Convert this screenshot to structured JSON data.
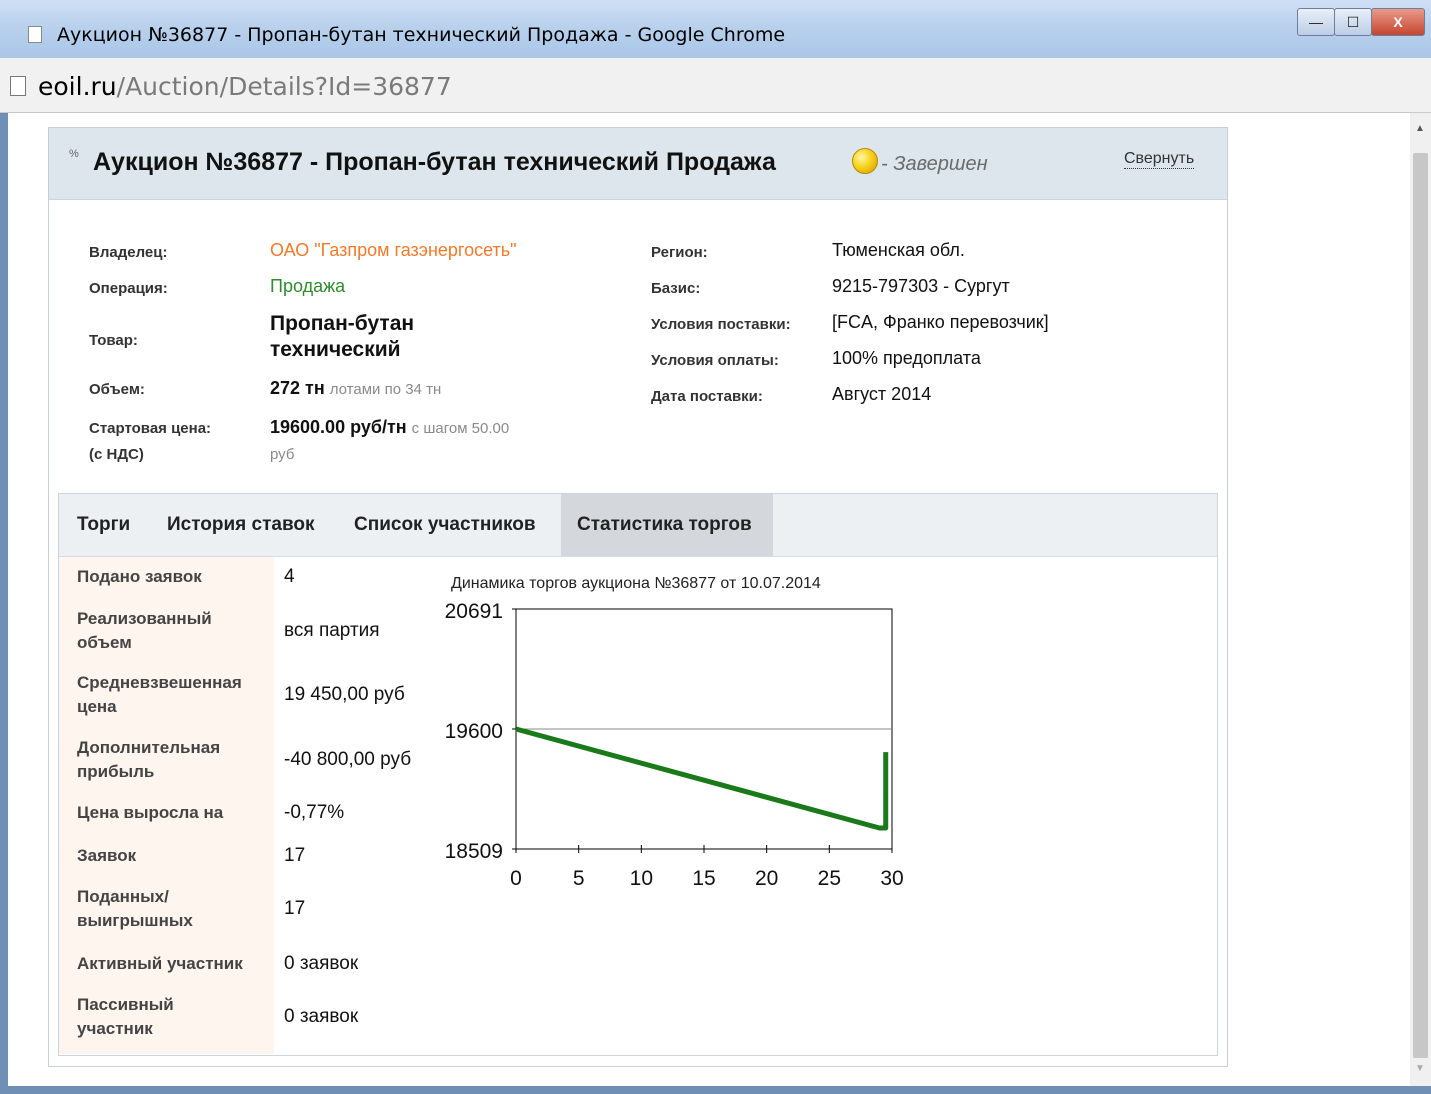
{
  "window": {
    "title": "Аукцион №36877 - Пропан-бутан технический Продажа - Google Chrome",
    "url_host": "eoil.ru",
    "url_path": "/Auction/Details?Id=36877",
    "controls": {
      "minimize": "—",
      "maximize": "☐",
      "close": "X"
    }
  },
  "header": {
    "title": "Аукцион №36877 - Пропан-бутан технический Продажа",
    "status": "- Завершен",
    "collapse": "Свернуть",
    "status_color": "#f7d21a"
  },
  "details": {
    "owner_label": "Владелец:",
    "owner_value": "ОАО \"Газпром газэнергосеть\"",
    "operation_label": "Операция:",
    "operation_value": "Продажа",
    "product_label": "Товар:",
    "product_value_line1": "Пропан-бутан",
    "product_value_line2": "технический",
    "volume_label": "Объем:",
    "volume_value": "272 тн",
    "volume_sub": "лотами по 34 тн",
    "price_label_line1": "Стартовая цена:",
    "price_label_line2": "(с НДС)",
    "price_value": "19600.00 руб/тн",
    "price_sub1": "с шагом 50.00",
    "price_sub2": "руб",
    "region_label": "Регион:",
    "region_value": "Тюменская обл.",
    "basis_label": "Базис:",
    "basis_value": "9215-797303 - Сургут",
    "delivery_terms_label": "Условия поставки:",
    "delivery_terms_value": "[FCA, Франко перевозчик]",
    "payment_terms_label": "Условия оплаты:",
    "payment_terms_value": "100% предоплата",
    "delivery_date_label": "Дата поставки:",
    "delivery_date_value": "Август 2014"
  },
  "tabs": [
    {
      "label": "Торги",
      "active": false
    },
    {
      "label": "История ставок",
      "active": false
    },
    {
      "label": "Список участников",
      "active": false
    },
    {
      "label": "Статистика торгов",
      "active": true
    }
  ],
  "stats": [
    {
      "label": "Подано заявок",
      "value": "4"
    },
    {
      "label": "Реализованный объем",
      "value": "вся партия"
    },
    {
      "label": "Средневзвешенная цена",
      "value": "19 450,00 руб"
    },
    {
      "label": "Дополнительная прибыль",
      "value": "-40 800,00 руб"
    },
    {
      "label": "Цена выросла на",
      "value": "-0,77%"
    },
    {
      "label": "Заявок",
      "value": "17"
    },
    {
      "label": "Поданных/ выигрышных",
      "value": "17"
    },
    {
      "label": "Активный участник",
      "value": "0 заявок"
    },
    {
      "label": "Пассивный участник",
      "value": "0 заявок"
    }
  ],
  "chart_data": {
    "type": "line",
    "title": "Динамика торгов аукциона №36877 от 10.07.2014",
    "xlabel": "",
    "ylabel": "",
    "xlim": [
      0,
      30
    ],
    "ylim": [
      18509,
      20691
    ],
    "x_ticks": [
      0,
      5,
      10,
      15,
      20,
      25,
      30
    ],
    "y_ticks": [
      18509,
      19600,
      20691
    ],
    "reference_line": 19600,
    "series": [
      {
        "color": "#1a7a1a",
        "points": [
          [
            0,
            19600
          ],
          [
            29,
            18700
          ],
          [
            29.5,
            18700
          ],
          [
            29.5,
            19390
          ]
        ]
      }
    ]
  }
}
